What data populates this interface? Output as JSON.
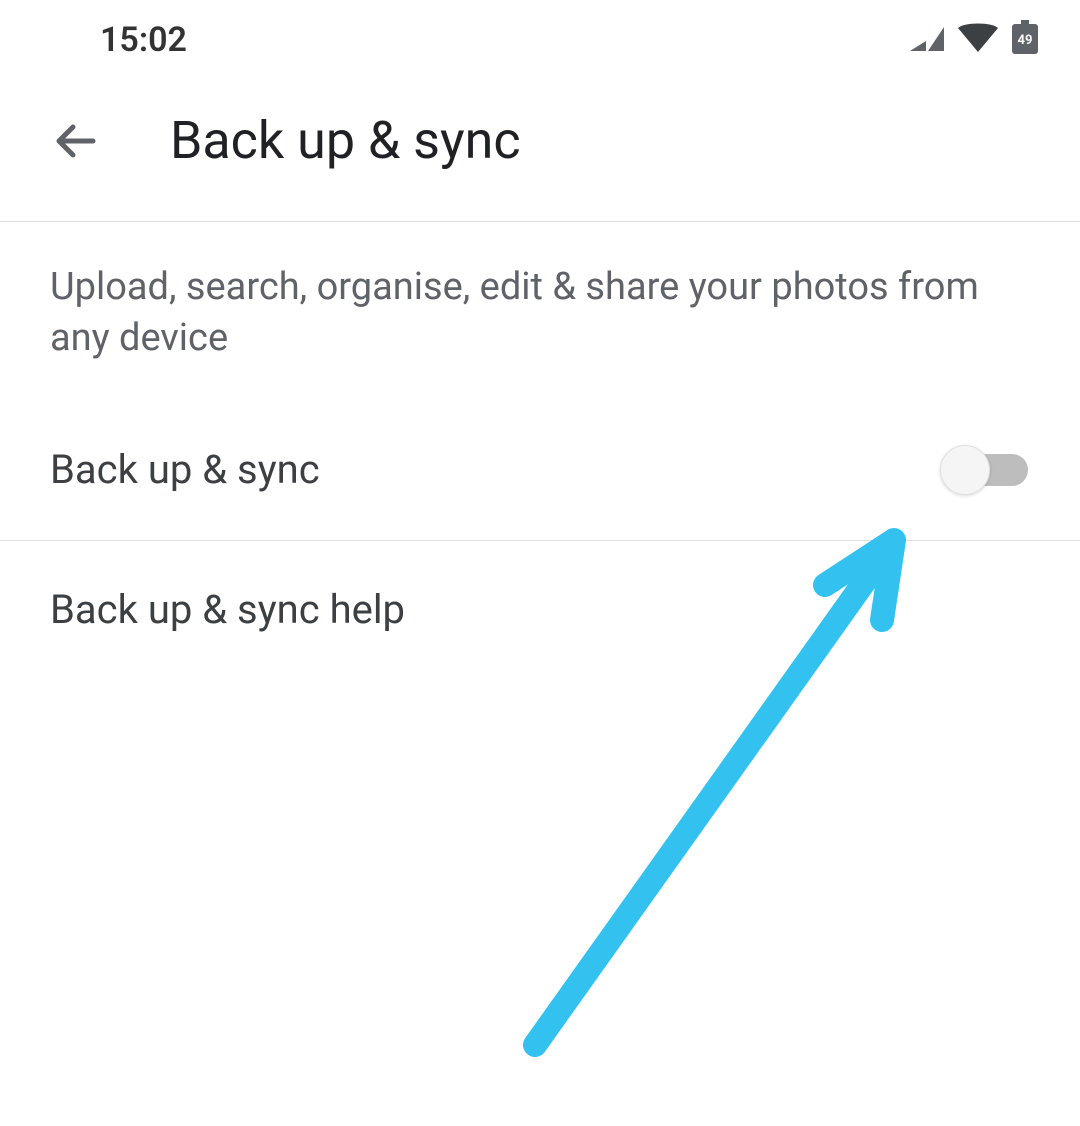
{
  "status_bar": {
    "time": "15:02",
    "battery_level": "49"
  },
  "header": {
    "title": "Back up & sync"
  },
  "description": "Upload, search, organise, edit & share your photos from any device",
  "settings": {
    "backup_sync": {
      "label": "Back up & sync",
      "enabled": false
    },
    "help": {
      "label": "Back up & sync help"
    }
  },
  "annotation": {
    "arrow_color": "#33c2f0"
  }
}
